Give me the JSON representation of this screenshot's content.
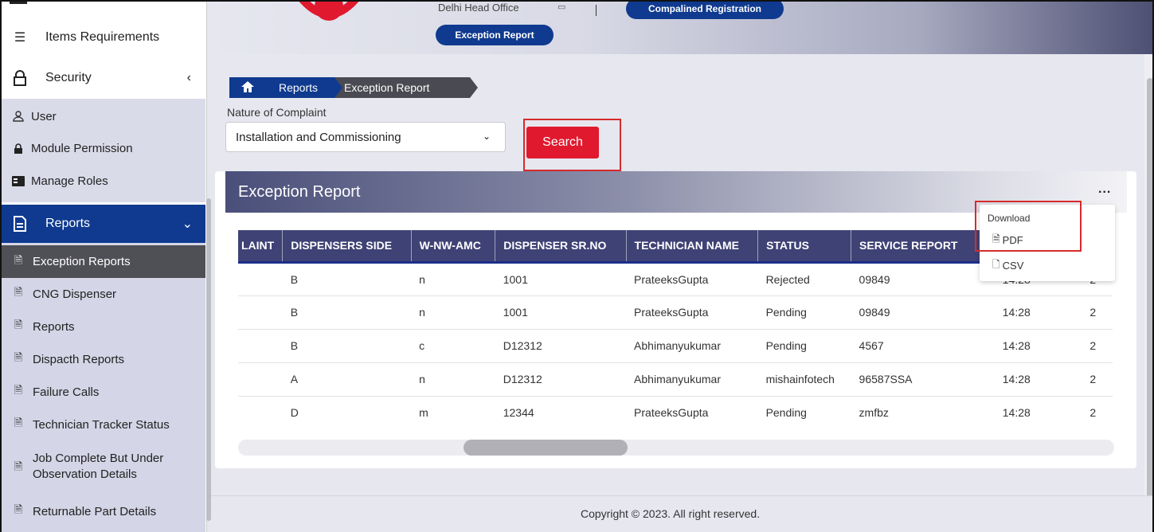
{
  "sidebar": {
    "items_requirements": "Items Requirements",
    "security": "Security",
    "security_sub": [
      "User",
      "Module Permission",
      "Manage Roles"
    ],
    "reports": "Reports",
    "report_items": [
      "Exception Reports",
      "CNG Dispenser",
      "Reports",
      "Dispacth Reports",
      "Failure Calls",
      "Technician Tracker Status",
      "Job Complete But Under Observation Details",
      "Returnable Part Details"
    ]
  },
  "header": {
    "office": "Delhi Head Office",
    "btn_complained": "Compalined Registration",
    "btn_exception": "Exception Report"
  },
  "breadcrumb": {
    "reports": "Reports",
    "current": "Exception Report"
  },
  "filter": {
    "label": "Nature of Complaint",
    "selected": "Installation and Commissioning",
    "search_label": "Search"
  },
  "card": {
    "title": "Exception Report",
    "menu": "..."
  },
  "download_menu": {
    "title": "Download",
    "pdf": "PDF",
    "csv": "CSV"
  },
  "table": {
    "columns": [
      "LAINT",
      "DISPENSERS SIDE",
      "W-NW-AMC",
      "DISPENSER SR.NO",
      "TECHNICIAN NAME",
      "STATUS",
      "SERVICE REPORT",
      "",
      ""
    ],
    "rows": [
      [
        "",
        "B",
        "n",
        "1001",
        "PrateeksGupta",
        "Rejected",
        "09849",
        "14:28",
        "2"
      ],
      [
        "",
        "B",
        "n",
        "1001",
        "PrateeksGupta",
        "Pending",
        "09849",
        "14:28",
        "2"
      ],
      [
        "",
        "B",
        "c",
        "D12312",
        "Abhimanyukumar",
        "Pending",
        "4567",
        "14:28",
        "2"
      ],
      [
        "",
        "A",
        "n",
        "D12312",
        "Abhimanyukumar",
        "mishainfotech",
        "96587SSA",
        "14:28",
        "2"
      ],
      [
        "",
        "D",
        "m",
        "12344",
        "PrateeksGupta",
        "Pending",
        "zmfbz",
        "14:28",
        "2"
      ]
    ]
  },
  "footer": "Copyright © 2023. All right reserved.",
  "colors": {
    "primary": "#0f3a8f",
    "accent": "#e0192e",
    "highlight": "#d62b2b"
  }
}
